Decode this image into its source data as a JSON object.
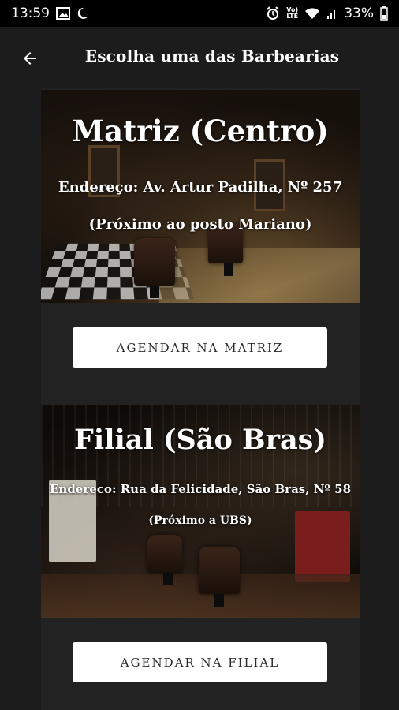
{
  "status_bar": {
    "time": "13:59",
    "network_top": "Vo)",
    "network_bottom": "LTE",
    "battery": "33%"
  },
  "app_bar": {
    "title": "Escolha uma das Barbearias",
    "back_icon": "arrow-left-icon"
  },
  "locations": [
    {
      "name": "Matriz (Centro)",
      "address": "Endereço: Av. Artur Padilha, Nº 257",
      "reference": "(Próximo ao posto Mariano)",
      "button_label": "AGENDAR NA MATRIZ"
    },
    {
      "name": "Filial (São Bras)",
      "address": "Endereco: Rua da Felicidade, São Bras, Nº 58",
      "reference": "(Próximo a UBS)",
      "button_label": "AGENDAR NA FILIAL"
    }
  ],
  "colors": {
    "background": "#1c1c1c",
    "column": "#222222",
    "button": "#ffffff",
    "status_bar": "#000000"
  }
}
